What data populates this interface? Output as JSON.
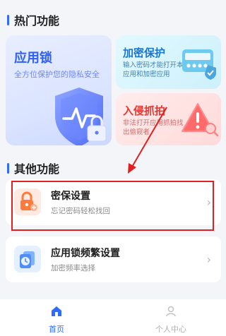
{
  "sections": {
    "hot": "热门功能",
    "other": "其他功能"
  },
  "cards": {
    "applock": {
      "title": "应用锁",
      "desc": "全方位保护您的隐私安全"
    },
    "encrypt": {
      "title": "加密保护",
      "desc": "输入密码才能打开本应用和加密应用"
    },
    "intrude": {
      "title": "入侵抓拍",
      "desc": "非法打开应用抓拍找出偷窥者"
    }
  },
  "list": [
    {
      "title": "密保设置",
      "subtitle": "忘记密码轻松找回"
    },
    {
      "title": "应用锁频繁设置",
      "subtitle": "加密频率选择"
    }
  ],
  "tabs": [
    {
      "label": "首页",
      "icon": "home-icon",
      "active": true
    },
    {
      "label": "个人中心",
      "icon": "person-icon",
      "active": false
    }
  ],
  "colors": {
    "accent": "#2f6bff",
    "danger": "#e53935",
    "highlight": "#e02020"
  }
}
